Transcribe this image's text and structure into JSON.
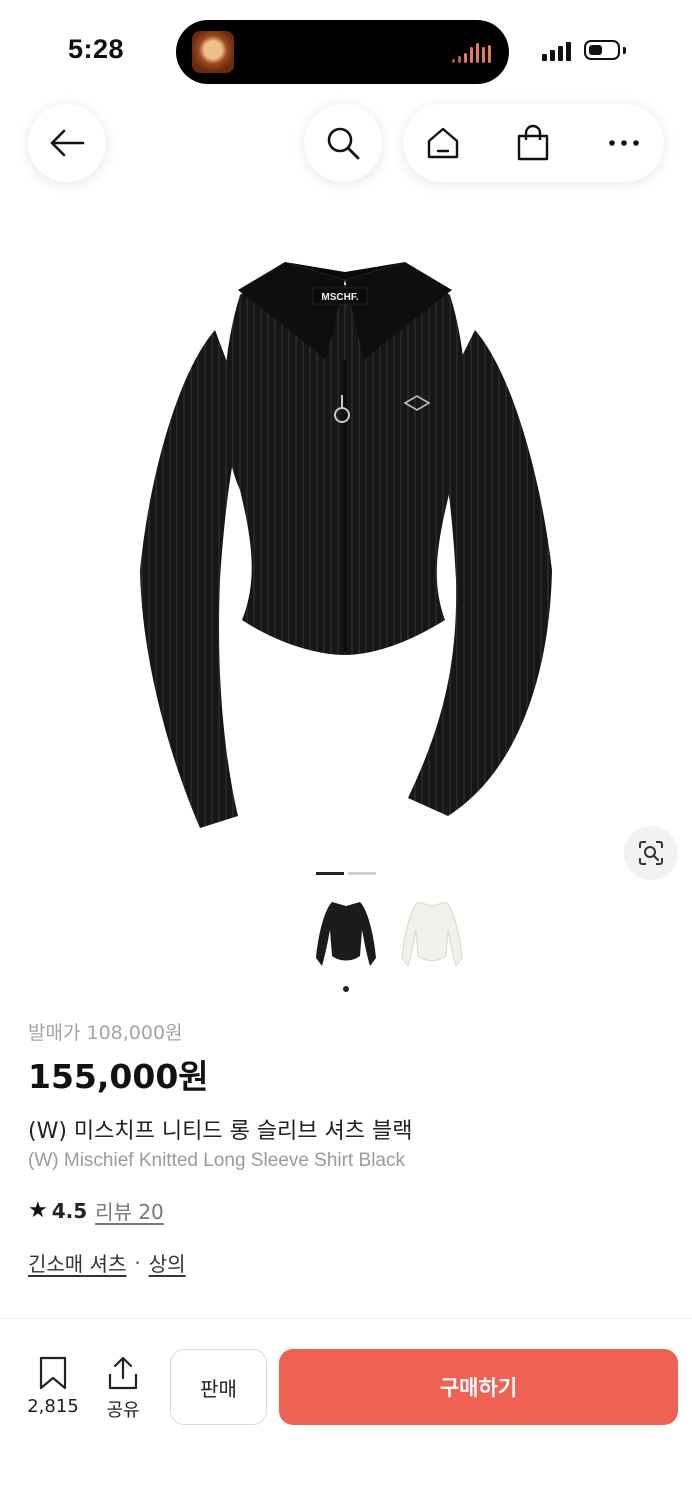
{
  "status_bar": {
    "time": "5:28",
    "icons": [
      "now-playing-artwork",
      "audio-wave",
      "cellular-signal",
      "battery"
    ]
  },
  "nav": {
    "icons": [
      "arrow-left-icon",
      "search-icon",
      "home-icon",
      "shopping-bag-icon",
      "more-icon"
    ]
  },
  "gallery": {
    "active_index": 0,
    "total": 2,
    "thumbnails": [
      {
        "color_name": "black",
        "color": "#1b1b1b"
      },
      {
        "color_name": "white",
        "color": "#f2f0ea"
      }
    ]
  },
  "product": {
    "release_price": "발매가 108,000원",
    "price": "155,000원",
    "name_ko": "(W) 미스치프 니티드 롱 슬리브 셔츠 블랙",
    "name_en": "(W) Mischief Knitted Long Sleeve Shirt Black",
    "rating": "4.5",
    "review": "리뷰 20",
    "category": "긴소매 셔츠",
    "separator": "·",
    "parent_category": "상의"
  },
  "bottom_bar": {
    "bookmark_count": "2,815",
    "share_label": "공유",
    "sell_label": "판매",
    "buy_label": "구매하기"
  },
  "colors": {
    "buy_button": "#ef6253"
  }
}
